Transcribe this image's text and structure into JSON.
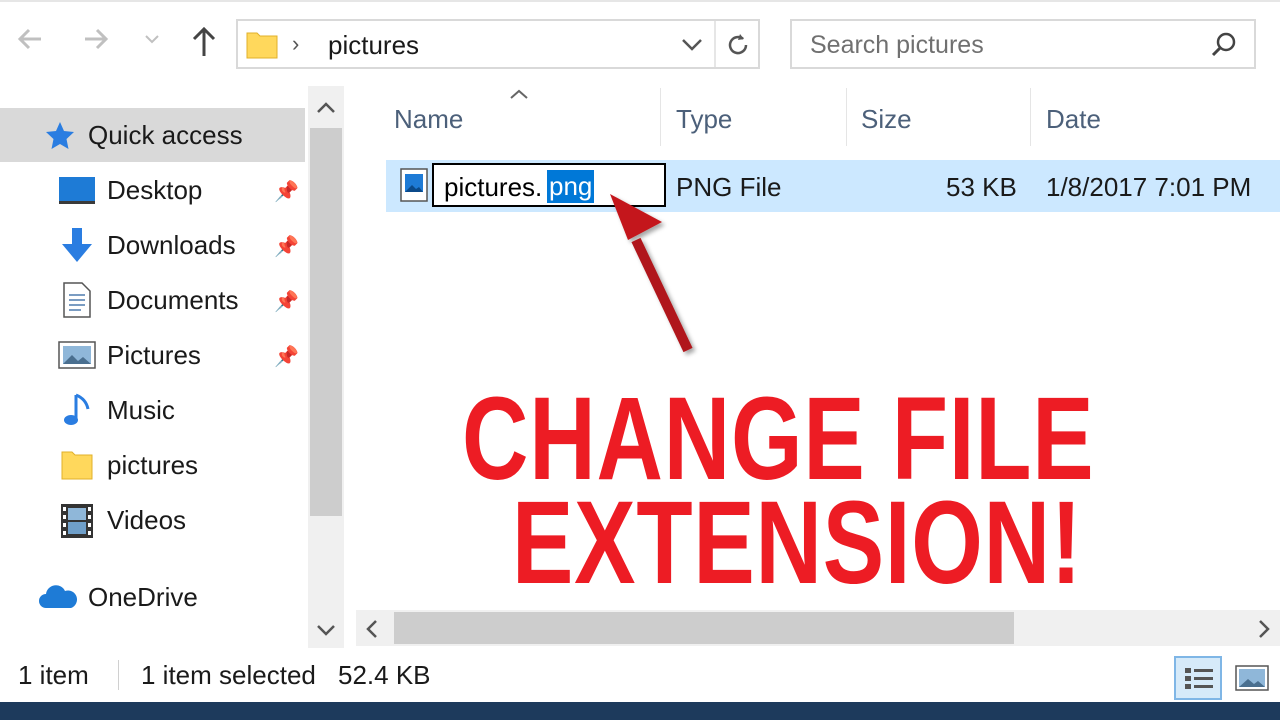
{
  "toolbar": {
    "back_icon": "arrow-left-icon",
    "forward_icon": "arrow-right-icon",
    "recent_icon": "chevron-down-icon",
    "up_icon": "arrow-up-icon",
    "address_path": "pictures",
    "refresh_icon": "refresh-icon",
    "search_placeholder": "Search pictures"
  },
  "sidebar": {
    "quick_access": "Quick access",
    "items": [
      {
        "label": "Desktop",
        "pinned": true
      },
      {
        "label": "Downloads",
        "pinned": true
      },
      {
        "label": "Documents",
        "pinned": true
      },
      {
        "label": "Pictures",
        "pinned": true
      },
      {
        "label": "Music",
        "pinned": false
      },
      {
        "label": "pictures",
        "pinned": false
      },
      {
        "label": "Videos",
        "pinned": false
      }
    ],
    "onedrive": "OneDrive"
  },
  "columns": {
    "name": "Name",
    "type": "Type",
    "size": "Size",
    "date": "Date"
  },
  "file": {
    "name_base": "pictures.",
    "name_ext": "png",
    "type": "PNG File",
    "size": "53 KB",
    "date": "1/8/2017 7:01 PM"
  },
  "headline": {
    "line1": "CHANGE FILE",
    "line2": "EXTENSION!"
  },
  "status": {
    "count": "1 item",
    "selected": "1 item selected",
    "size": "52.4 KB"
  },
  "colors": {
    "accent_red": "#ed1c24",
    "selection": "#cce8ff",
    "folder": "#ffd85c",
    "icon_blue": "#1e7bd6"
  }
}
